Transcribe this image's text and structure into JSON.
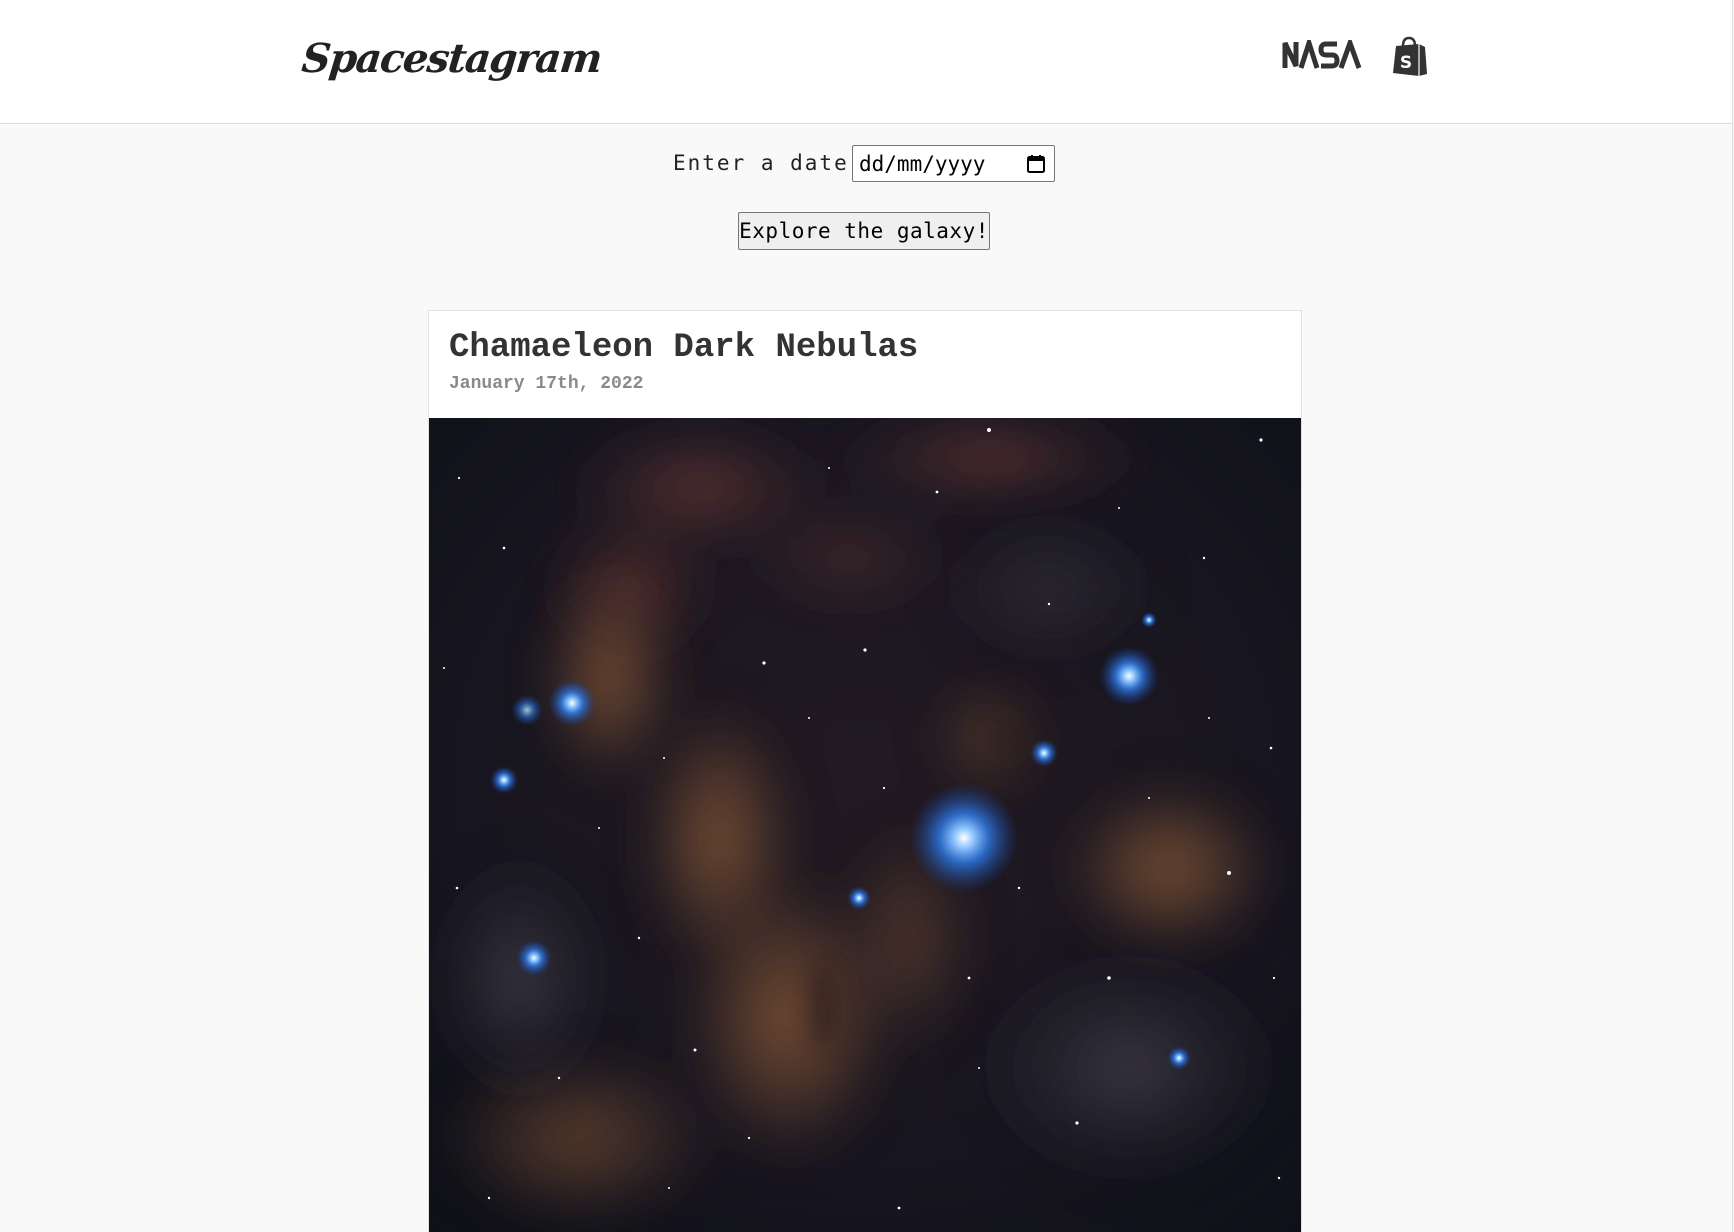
{
  "header": {
    "brand": "Spacestagram",
    "nasa_logo_text": "NASA",
    "shop_logo_glyph": "S",
    "nasa_icon": "nasa-logo",
    "shop_icon": "shopify-bag-logo"
  },
  "search": {
    "label": "Enter a date:",
    "date_placeholder": "dd/mm/yyyy",
    "date_value": "",
    "calendar_icon": "calendar-icon",
    "submit_label": "Explore the galaxy!"
  },
  "post": {
    "title": "Chamaeleon Dark Nebulas",
    "date": "January 17th, 2022",
    "image_subject": "dark nebula starfield with blue reflection nebulae"
  },
  "colors": {
    "page_bg": "#f9f9f9",
    "header_bg": "#ffffff",
    "title_text": "#333333",
    "date_text": "#8a8a8a",
    "button_bg": "#efefef"
  }
}
